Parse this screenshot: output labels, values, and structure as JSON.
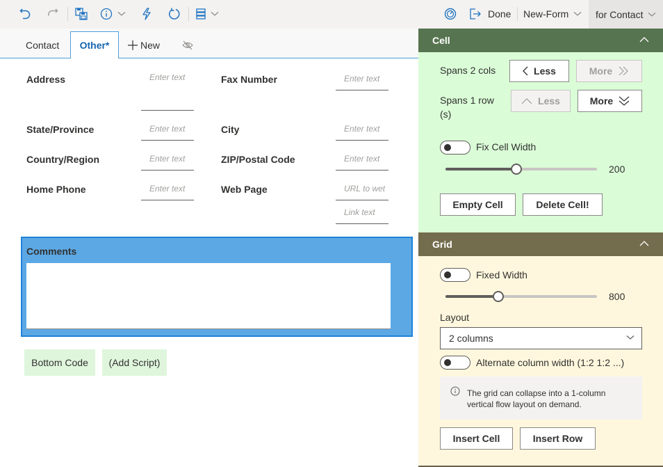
{
  "toolbar": {
    "icons": [
      "undo-icon",
      "redo-icon",
      "save-icon",
      "info-icon",
      "lightning-icon",
      "refresh-icon",
      "list-icon",
      "gauge-icon",
      "exit-icon"
    ],
    "done_label": "Done",
    "form_name": "New-Form",
    "form_target": "for Contact"
  },
  "tabs": {
    "items": [
      {
        "label": "Contact",
        "active": false
      },
      {
        "label": "Other*",
        "active": true
      }
    ],
    "new_label": "New"
  },
  "form": {
    "fields": [
      {
        "label": "Address",
        "placeholder": "Enter text"
      },
      {
        "label": "Fax Number",
        "placeholder": "Enter text"
      },
      {
        "label": "State/Province",
        "placeholder": "Enter text"
      },
      {
        "label": "City",
        "placeholder": "Enter text"
      },
      {
        "label": "Country/Region",
        "placeholder": "Enter text"
      },
      {
        "label": "ZIP/Postal Code",
        "placeholder": "Enter text"
      },
      {
        "label": "Home Phone",
        "placeholder": "Enter text"
      },
      {
        "label": "Web Page",
        "placeholder": "URL to wet",
        "placeholder2": "Link text"
      }
    ],
    "comments_label": "Comments",
    "bottom_code_label": "Bottom Code",
    "add_script_label": "(Add Script)"
  },
  "cell_panel": {
    "title": "Cell",
    "spans_cols_label": "Spans 2 cols",
    "spans_rows_label": "Spans 1 row (s)",
    "less_label": "Less",
    "more_label": "More",
    "fix_width_label": "Fix Cell Width",
    "fix_width_on": false,
    "width_value": "200",
    "width_fraction": 0.47,
    "empty_cell_label": "Empty Cell",
    "delete_cell_label": "Delete Cell!"
  },
  "grid_panel": {
    "title": "Grid",
    "fixed_width_label": "Fixed Width",
    "fixed_width_on": false,
    "width_value": "800",
    "width_fraction": 0.35,
    "layout_label": "Layout",
    "layout_value": "2 columns",
    "alternate_label": "Alternate column width (1:2 1:2 ...)",
    "alternate_on": false,
    "info_text": "The grid can collapse into a 1-column vertical flow layout on demand.",
    "insert_cell_label": "Insert Cell",
    "insert_row_label": "Insert Row"
  },
  "colors": {
    "accent": "#1566b0",
    "cell_header": "#56744f",
    "cell_body": "#dafcd7",
    "grid_header": "#736c4d",
    "grid_body": "#fef7dd",
    "comments_bg": "#5ca8e4",
    "green_button": "#dff6dd"
  }
}
